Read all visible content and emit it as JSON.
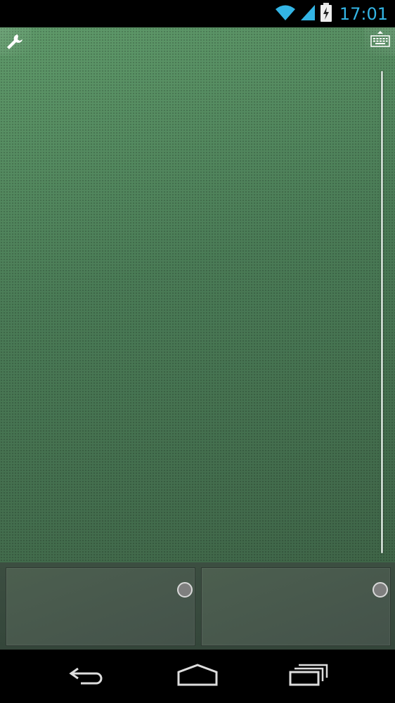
{
  "status_bar": {
    "time": "17:01",
    "icons": [
      "wifi-icon",
      "signal-icon",
      "battery-charging-icon"
    ],
    "accent_color": "#33b5e5"
  },
  "toolbar": {
    "settings_icon": "wrench-icon",
    "keyboard_icon": "keyboard-icon"
  },
  "touchpad": {
    "background_color": "#4f8159",
    "scrollbar": "vertical-scroll-strip"
  },
  "mouse_buttons": [
    {
      "name": "left-mouse-button",
      "indicator": "circle-indicator"
    },
    {
      "name": "right-mouse-button",
      "indicator": "circle-indicator"
    }
  ],
  "nav_bar": {
    "buttons": [
      "back-icon",
      "home-icon",
      "recent-apps-icon"
    ]
  }
}
